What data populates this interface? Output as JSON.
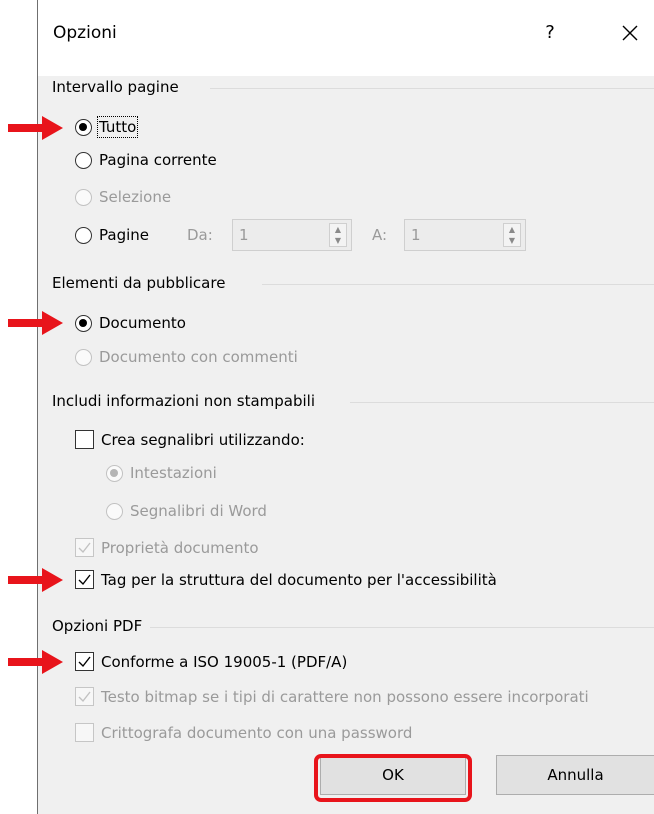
{
  "dialog": {
    "title": "Opzioni",
    "help_label": "?",
    "close_icon": "close-icon"
  },
  "page_range": {
    "title": "Intervallo pagine",
    "all": "Tutto",
    "current": "Pagina corrente",
    "selection": "Selezione",
    "pages": "Pagine",
    "from_label": "Da:",
    "from_value": "1",
    "to_label": "A:",
    "to_value": "1",
    "selected": "Tutto"
  },
  "publish": {
    "title": "Elementi da pubblicare",
    "document": "Documento",
    "document_with_comments": "Documento con commenti",
    "selected": "Documento"
  },
  "non_printing": {
    "title": "Includi informazioni non stampabili",
    "create_bookmarks": "Crea segnalibri utilizzando:",
    "headings": "Intestazioni",
    "word_bookmarks": "Segnalibri di Word",
    "doc_properties": "Proprietà documento",
    "tags": "Tag per la struttura del documento per l'accessibilità"
  },
  "pdf_options": {
    "title": "Opzioni PDF",
    "iso": "Conforme a ISO 19005-1 (PDF/A)",
    "bitmap_text": "Testo bitmap se i tipi di carattere non possono essere incorporati",
    "encrypt": "Crittografa documento con una password"
  },
  "buttons": {
    "ok": "OK",
    "cancel": "Annulla"
  },
  "colors": {
    "annotation_red": "#e8141b",
    "dialog_bg": "#f0f0f0"
  }
}
